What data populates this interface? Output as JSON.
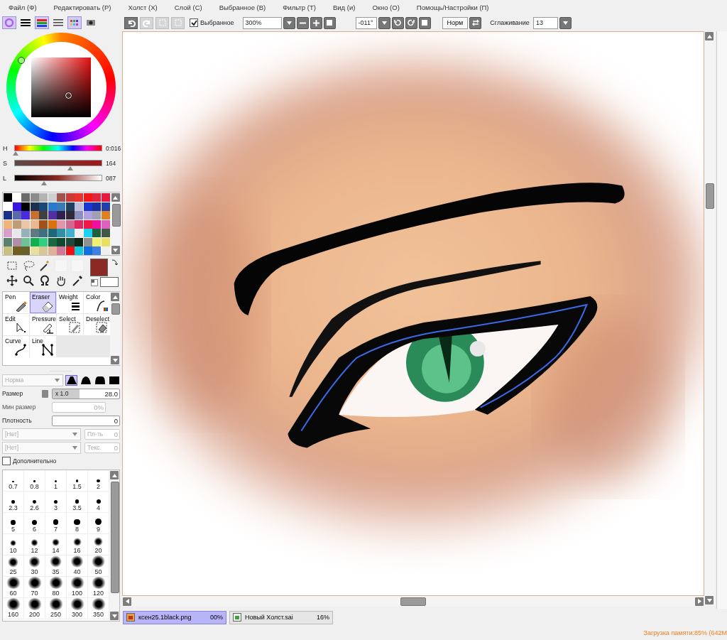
{
  "menu": [
    "Файл (Ф)",
    "Редактировать (Р)",
    "Холст (Х)",
    "Слой (С)",
    "Выбранное (В)",
    "Фильтр (Т)",
    "Вид (и)",
    "Окно (О)",
    "Помощь/Настройки (П)"
  ],
  "panel_toggles": [
    {
      "kind": "wheel",
      "selected": true
    },
    {
      "kind": "sliders",
      "selected": false
    },
    {
      "kind": "rgb",
      "selected": true
    },
    {
      "kind": "list",
      "selected": false
    },
    {
      "kind": "palette",
      "selected": true
    },
    {
      "kind": "scratch",
      "selected": false
    }
  ],
  "canvas_toolbar": {
    "history_buttons": [
      {
        "kind": "undo",
        "disabled": false
      },
      {
        "kind": "redo",
        "disabled": true
      },
      {
        "kind": "deselect",
        "disabled": true
      },
      {
        "kind": "invert",
        "disabled": true
      }
    ],
    "selection_checkbox": {
      "label": "Выбранное",
      "checked": true
    },
    "zoom": "300%",
    "angle": "-011°",
    "mode_button": "Норм",
    "smoothing_label": "Сглаживание",
    "smoothing": "13"
  },
  "color_sliders": [
    {
      "label": "H",
      "value": "0:016",
      "level": 0.02,
      "kind": "hue"
    },
    {
      "label": "S",
      "value": "164",
      "level": 0.64,
      "kind": "saturation"
    },
    {
      "label": "L",
      "value": "087",
      "level": 0.34,
      "kind": "lightness"
    }
  ],
  "swatches": [
    {
      "kind": "foreground",
      "color": "#8b2a24"
    },
    {
      "kind": "background",
      "color": "#ffffff"
    }
  ],
  "tools": [
    {
      "label": "Pen",
      "kind": "pen",
      "selected": false
    },
    {
      "label": "Eraser",
      "kind": "eraser",
      "selected": true
    },
    {
      "label": "Weight",
      "kind": "weight",
      "selected": false
    },
    {
      "label": "Color",
      "kind": "color",
      "selected": false
    },
    {
      "label": "Edit",
      "kind": "edit",
      "selected": false
    },
    {
      "label": "Pressure",
      "kind": "pressure",
      "selected": false
    },
    {
      "label": "Select",
      "kind": "select",
      "selected": false
    },
    {
      "label": "Deselect",
      "kind": "deselect",
      "selected": false
    },
    {
      "label": "Curve",
      "kind": "curve",
      "selected": false
    },
    {
      "label": "Line",
      "kind": "line",
      "selected": false
    }
  ],
  "brush": {
    "mode": "Норма",
    "shapes": [
      {
        "selected": true
      },
      {
        "selected": false
      },
      {
        "selected": false
      },
      {
        "selected": false
      }
    ],
    "size_label": "Размер",
    "size_multiplier": "x 1.0",
    "size": "28.0",
    "min_size_label": "Мин размер",
    "min_size": "0%",
    "density_label": "Плотность",
    "density": "0",
    "texture_rows": [
      {
        "value": "[Нет]",
        "label": "Пл-ть",
        "amount": "0"
      },
      {
        "value": "[Нет]",
        "label": "Текс.",
        "amount": "0"
      }
    ],
    "advanced": {
      "label": "Дополнительно",
      "checked": false
    }
  },
  "brush_sizes": [
    "0.7",
    "0.8",
    "1",
    "1.5",
    "2",
    "2.3",
    "2.6",
    "3",
    "3.5",
    "4",
    "5",
    "6",
    "7",
    "8",
    "9",
    "10",
    "12",
    "14",
    "16",
    "20",
    "25",
    "30",
    "35",
    "40",
    "50",
    "60",
    "70",
    "80",
    "100",
    "120",
    "160",
    "200",
    "250",
    "300",
    "350"
  ],
  "documents": [
    {
      "name": "ксен25.1black.png",
      "percent": "00%",
      "selected": true
    },
    {
      "name": "Новый Холст.sai",
      "percent": "16%",
      "selected": false
    }
  ],
  "status_bar": "Загрузка памяти:85% (642M"
}
